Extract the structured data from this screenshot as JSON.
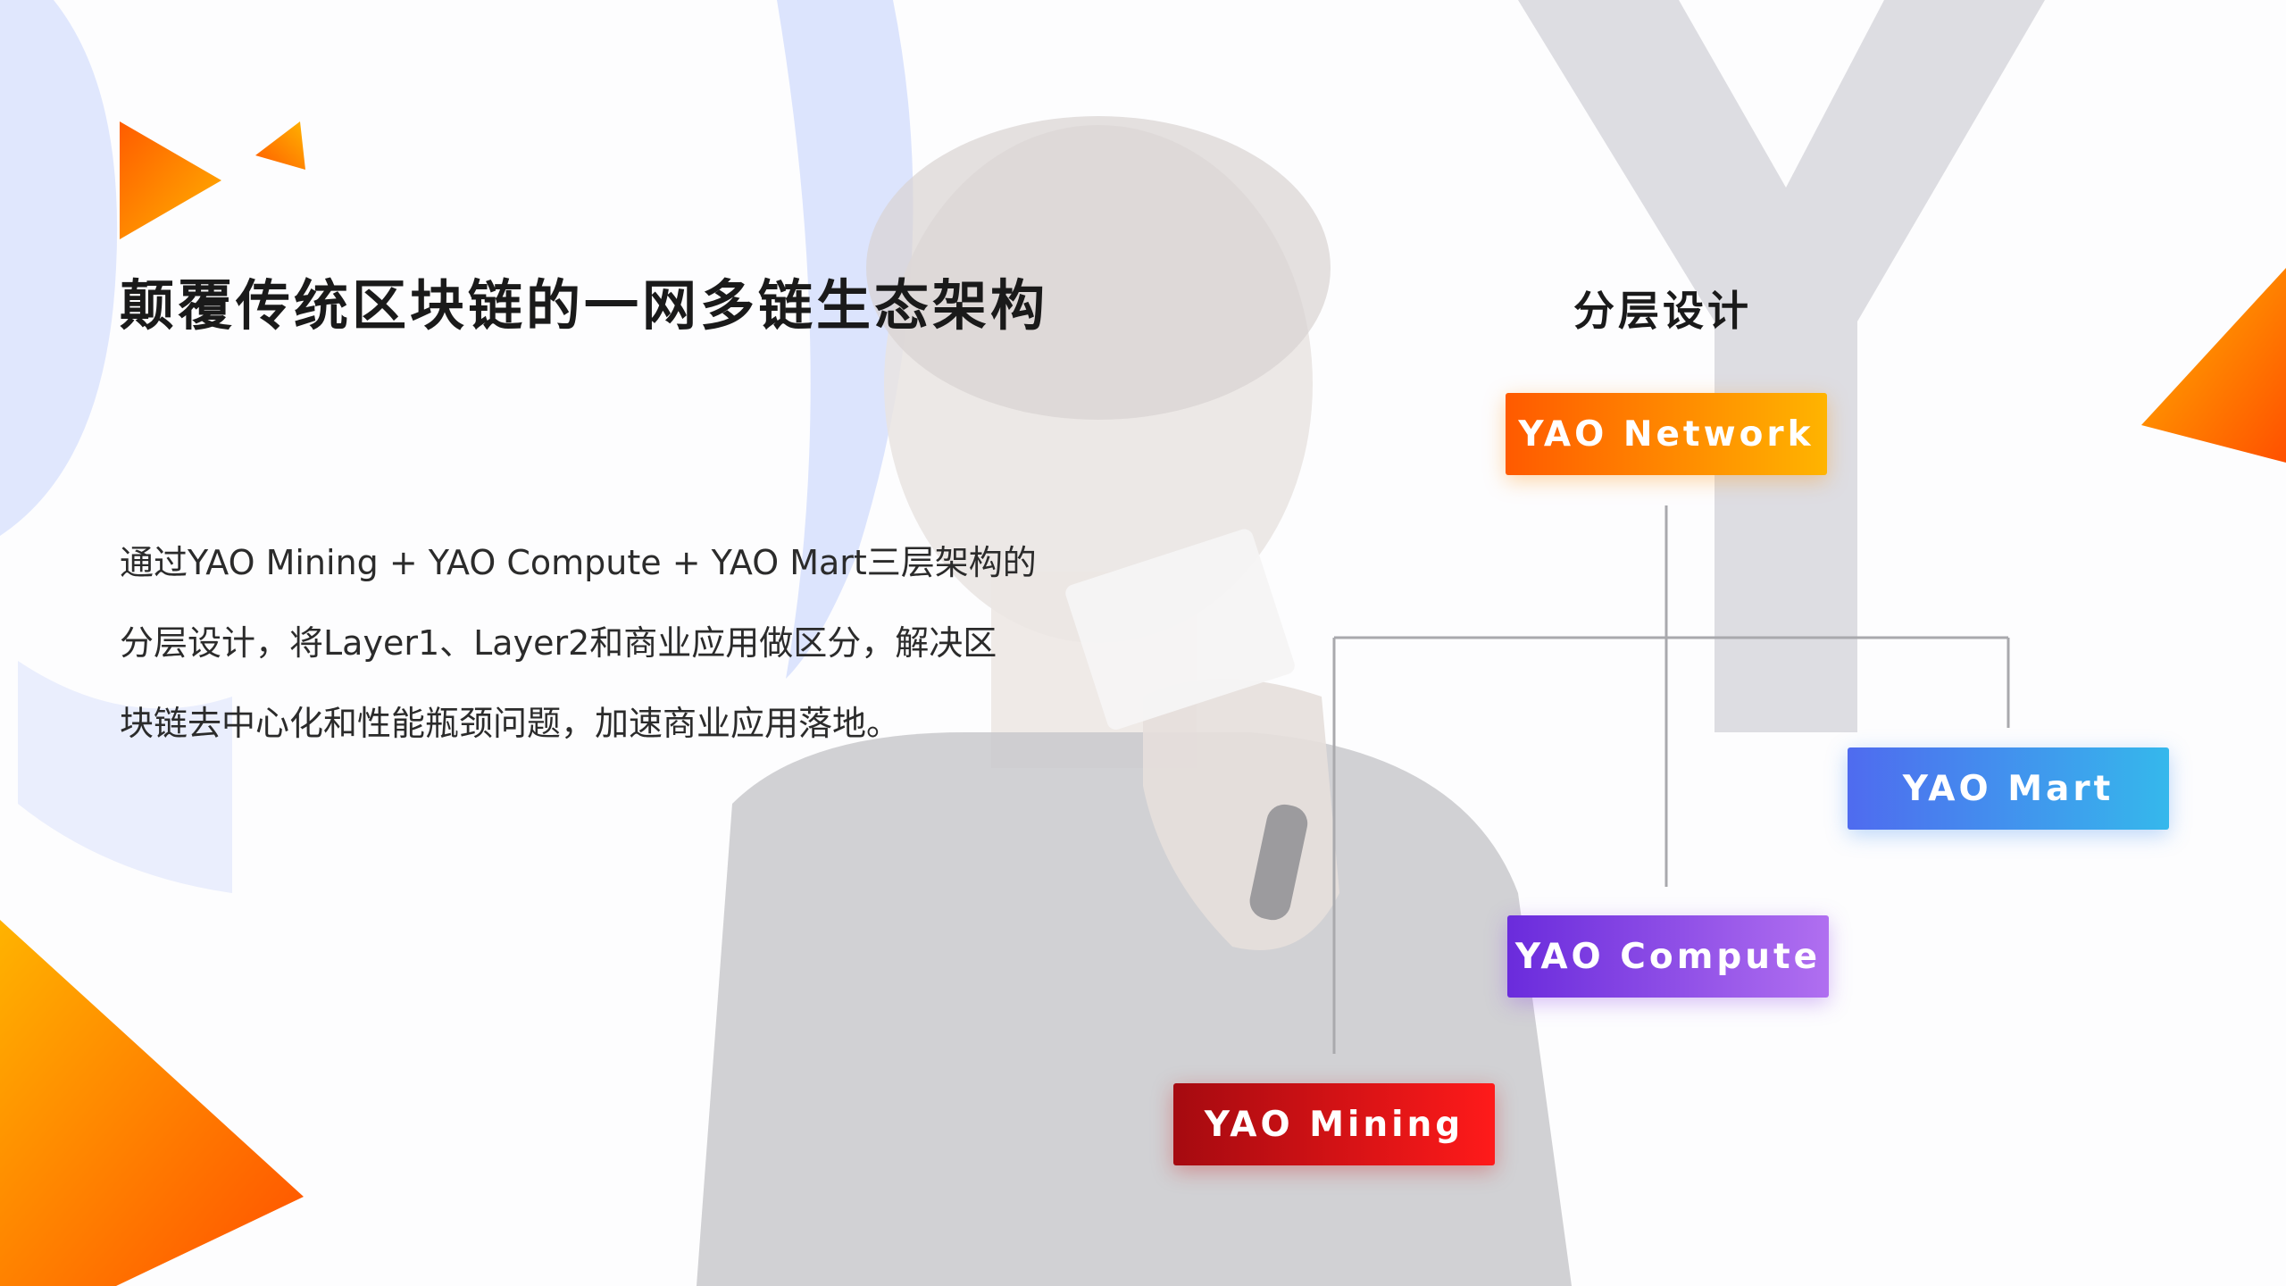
{
  "title": "颠覆传统区块链的一网多链生态架构",
  "description_lines": [
    "通过YAO Mining + YAO Compute + YAO Mart三层架构的",
    "分层设计，将Layer1、Layer2和商业应用做区分，解决区",
    "块链去中心化和性能瓶颈问题，加速商业应用落地。"
  ],
  "diagram": {
    "title": "分层设计",
    "nodes": {
      "network": "YAO Network",
      "mart": "YAO Mart",
      "compute": "YAO Compute",
      "mining": "YAO Mining"
    }
  },
  "colors": {
    "accent_orange": "#ff8a00",
    "network_gradient": [
      "#ff5a00",
      "#ffb400"
    ],
    "mart_gradient": [
      "#4f6bef",
      "#35b8ec"
    ],
    "compute_gradient": [
      "#6a2bdc",
      "#b06ff0"
    ],
    "mining_gradient": [
      "#a50a10",
      "#ff1a1a"
    ]
  }
}
